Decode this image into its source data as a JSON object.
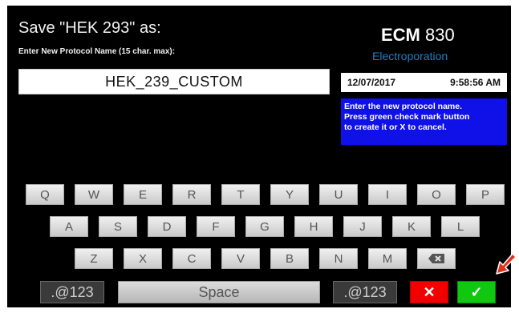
{
  "header": {
    "title": "Save \"HEK 293\" as:",
    "subtitle": "Enter New Protocol Name (15 char. max):"
  },
  "name_field": {
    "value": "HEK_239_CUSTOM"
  },
  "brand": {
    "model_prefix": "ECM",
    "model_number": "830",
    "product": "Electroporation"
  },
  "datetime": {
    "date": "12/07/2017",
    "time": "9:58:56 AM"
  },
  "info": {
    "lines": [
      "Enter the new protocol name.",
      "Press green check mark button",
      "to create it or X to cancel."
    ]
  },
  "keyboard": {
    "row1": [
      "Q",
      "W",
      "E",
      "R",
      "T",
      "Y",
      "U",
      "I",
      "O",
      "P"
    ],
    "row2": [
      "A",
      "S",
      "D",
      "F",
      "G",
      "H",
      "J",
      "K",
      "L"
    ],
    "row3": [
      "Z",
      "X",
      "C",
      "V",
      "B",
      "N",
      "M"
    ],
    "backspace_icon": "backspace-icon",
    "symbols_label": ".@123",
    "space_label": "Space",
    "cancel_glyph": "✕",
    "confirm_glyph": "✓"
  },
  "colors": {
    "screen_bg": "#000000",
    "info_bg": "#1010e8",
    "brand_accent": "#1f7fc4",
    "cancel": "#f20000",
    "confirm": "#10c810",
    "pointer_arrow": "#e0301e"
  },
  "overlay": {
    "icon": "pointer-arrow-icon"
  }
}
